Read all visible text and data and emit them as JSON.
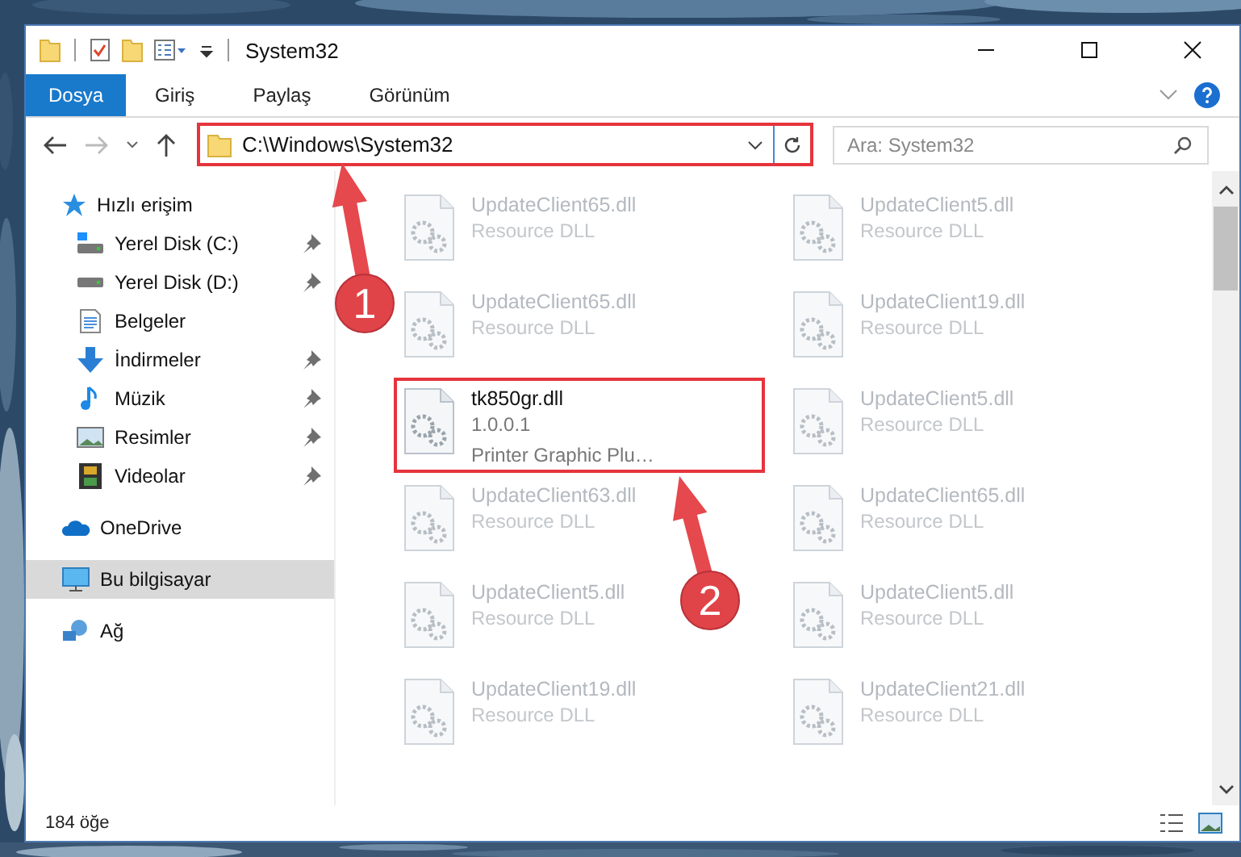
{
  "window": {
    "title": "System32"
  },
  "ribbon_tabs": [
    {
      "label": "Dosya",
      "selected": true
    },
    {
      "label": "Giriş",
      "selected": false
    },
    {
      "label": "Paylaş",
      "selected": false
    },
    {
      "label": "Görünüm",
      "selected": false
    }
  ],
  "address_bar": {
    "path": "C:\\Windows\\System32",
    "highlighted": true
  },
  "search": {
    "placeholder": "Ara: System32"
  },
  "navigation": [
    {
      "label": "Hızlı erişim",
      "kind": "star",
      "selected": false,
      "children": [
        {
          "label": "Yerel Disk (C:)",
          "kind": "drive-windows",
          "pinned": true,
          "selected": false
        },
        {
          "label": "Yerel Disk (D:)",
          "kind": "drive",
          "pinned": true,
          "selected": false
        },
        {
          "label": "Belgeler",
          "kind": "document",
          "pinned": false,
          "selected": false
        },
        {
          "label": "İndirmeler",
          "kind": "download",
          "pinned": true,
          "selected": false
        },
        {
          "label": "Müzik",
          "kind": "music",
          "pinned": true,
          "selected": false
        },
        {
          "label": "Resimler",
          "kind": "pictures",
          "pinned": true,
          "selected": false
        },
        {
          "label": "Videolar",
          "kind": "video",
          "pinned": true,
          "selected": false
        }
      ]
    },
    {
      "label": "OneDrive",
      "kind": "cloud",
      "selected": false
    },
    {
      "label": "Bu bilgisayar",
      "kind": "computer",
      "selected": true
    },
    {
      "label": "Ağ",
      "kind": "network",
      "selected": false
    }
  ],
  "files": [
    {
      "name": "UpdateClient65.dll",
      "lines": [
        "Resource DLL"
      ],
      "dimmed": true,
      "highlighted": false
    },
    {
      "name": "UpdateClient5.dll",
      "lines": [
        "Resource DLL"
      ],
      "dimmed": true,
      "highlighted": false
    },
    {
      "name": "UpdateClient65.dll",
      "lines": [
        "Resource DLL"
      ],
      "dimmed": true,
      "highlighted": false
    },
    {
      "name": "UpdateClient19.dll",
      "lines": [
        "Resource DLL"
      ],
      "dimmed": true,
      "highlighted": false
    },
    {
      "name": "tk850gr.dll",
      "lines": [
        "1.0.0.1",
        "Printer Graphic Plu…"
      ],
      "dimmed": false,
      "highlighted": true
    },
    {
      "name": "UpdateClient5.dll",
      "lines": [
        "Resource DLL"
      ],
      "dimmed": true,
      "highlighted": false
    },
    {
      "name": "UpdateClient63.dll",
      "lines": [
        "Resource DLL"
      ],
      "dimmed": true,
      "highlighted": false
    },
    {
      "name": "UpdateClient65.dll",
      "lines": [
        "Resource DLL"
      ],
      "dimmed": true,
      "highlighted": false
    },
    {
      "name": "UpdateClient5.dll",
      "lines": [
        "Resource DLL"
      ],
      "dimmed": true,
      "highlighted": false
    },
    {
      "name": "UpdateClient5.dll",
      "lines": [
        "Resource DLL"
      ],
      "dimmed": true,
      "highlighted": false
    },
    {
      "name": "UpdateClient19.dll",
      "lines": [
        "Resource DLL"
      ],
      "dimmed": true,
      "highlighted": false
    },
    {
      "name": "UpdateClient21.dll",
      "lines": [
        "Resource DLL"
      ],
      "dimmed": true,
      "highlighted": false
    }
  ],
  "status_bar": {
    "item_count": "184 öğe"
  },
  "annotations": [
    {
      "label": "1"
    },
    {
      "label": "2"
    }
  ]
}
